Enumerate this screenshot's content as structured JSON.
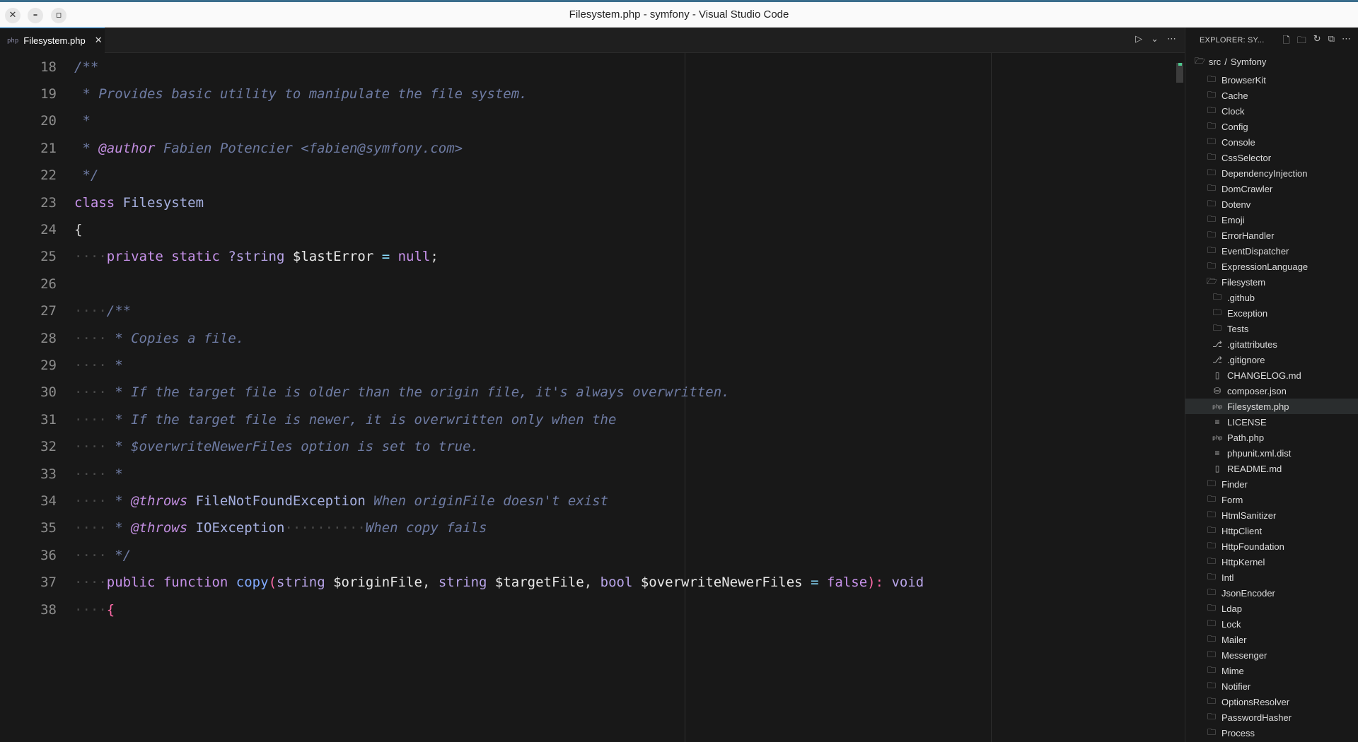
{
  "window": {
    "title": "Filesystem.php - symfony - Visual Studio Code"
  },
  "tab": {
    "label": "Filesystem.php",
    "icon": "php-file-icon"
  },
  "editor": {
    "lines": [
      {
        "num": "18",
        "tokens": [
          [
            "/**",
            "cm"
          ]
        ]
      },
      {
        "num": "19",
        "tokens": [
          [
            " * Provides basic utility to manipulate the file system.",
            "cm"
          ]
        ]
      },
      {
        "num": "20",
        "tokens": [
          [
            " *",
            "cm"
          ]
        ]
      },
      {
        "num": "21",
        "tokens": [
          [
            " * ",
            "cm"
          ],
          [
            "@author",
            "tag"
          ],
          [
            " Fabien Potencier <fabien@symfony.com>",
            "cm"
          ]
        ]
      },
      {
        "num": "22",
        "tokens": [
          [
            " */",
            "cm"
          ]
        ]
      },
      {
        "num": "23",
        "tokens": [
          [
            "class ",
            "kw"
          ],
          [
            "Filesystem",
            "cls"
          ]
        ]
      },
      {
        "num": "24",
        "tokens": [
          [
            "{",
            "plain"
          ]
        ]
      },
      {
        "num": "25",
        "tokens": [
          [
            "····",
            "ws"
          ],
          [
            "private static ",
            "kw"
          ],
          [
            "?string ",
            "type"
          ],
          [
            "$lastError",
            "var"
          ],
          [
            " = ",
            "op"
          ],
          [
            "null",
            "kw"
          ],
          [
            ";",
            "plain"
          ]
        ]
      },
      {
        "num": "26",
        "tokens": []
      },
      {
        "num": "27",
        "tokens": [
          [
            "····",
            "ws"
          ],
          [
            "/**",
            "cm"
          ]
        ]
      },
      {
        "num": "28",
        "tokens": [
          [
            "····",
            "ws"
          ],
          [
            " * Copies a file.",
            "cm"
          ]
        ]
      },
      {
        "num": "29",
        "tokens": [
          [
            "····",
            "ws"
          ],
          [
            " *",
            "cm"
          ]
        ]
      },
      {
        "num": "30",
        "tokens": [
          [
            "····",
            "ws"
          ],
          [
            " * If the target file is older than the origin file, it's always overwritten.",
            "cm"
          ]
        ]
      },
      {
        "num": "31",
        "tokens": [
          [
            "····",
            "ws"
          ],
          [
            " * If the target file is newer, it is overwritten only when the",
            "cm"
          ]
        ]
      },
      {
        "num": "32",
        "tokens": [
          [
            "····",
            "ws"
          ],
          [
            " * $overwriteNewerFiles option is set to true.",
            "cm"
          ]
        ]
      },
      {
        "num": "33",
        "tokens": [
          [
            "····",
            "ws"
          ],
          [
            " *",
            "cm"
          ]
        ]
      },
      {
        "num": "34",
        "tokens": [
          [
            "····",
            "ws"
          ],
          [
            " * ",
            "cm"
          ],
          [
            "@throws",
            "tag"
          ],
          [
            " FileNotFoundException",
            "cls"
          ],
          [
            " When originFile doesn't exist",
            "cm"
          ]
        ]
      },
      {
        "num": "35",
        "tokens": [
          [
            "····",
            "ws"
          ],
          [
            " * ",
            "cm"
          ],
          [
            "@throws",
            "tag"
          ],
          [
            " IOException",
            "cls"
          ],
          [
            "··········",
            "ws"
          ],
          [
            "When copy fails",
            "cm"
          ]
        ]
      },
      {
        "num": "36",
        "tokens": [
          [
            "····",
            "ws"
          ],
          [
            " */",
            "cm"
          ]
        ]
      },
      {
        "num": "37",
        "tokens": [
          [
            "····",
            "ws"
          ],
          [
            "public function ",
            "kw"
          ],
          [
            "copy",
            "fn"
          ],
          [
            "(",
            "brace"
          ],
          [
            "string ",
            "type"
          ],
          [
            "$originFile",
            "var"
          ],
          [
            ", ",
            "plain"
          ],
          [
            "string ",
            "type"
          ],
          [
            "$targetFile",
            "var"
          ],
          [
            ", ",
            "plain"
          ],
          [
            "bool ",
            "type"
          ],
          [
            "$overwriteNewerFiles",
            "var"
          ],
          [
            " = ",
            "op"
          ],
          [
            "false",
            "kw"
          ],
          [
            "): ",
            "brace"
          ],
          [
            "void",
            "type"
          ]
        ]
      },
      {
        "num": "38",
        "tokens": [
          [
            "····",
            "ws"
          ],
          [
            "{",
            "brace"
          ]
        ]
      }
    ]
  },
  "explorer": {
    "header": "EXPLORER: SY...",
    "crumb": {
      "part1": "src",
      "sep": "/",
      "part2": "Symfony"
    },
    "items": [
      {
        "label": "BrowserKit",
        "icon": "folder-icon",
        "depth": 1
      },
      {
        "label": "Cache",
        "icon": "folder-icon",
        "depth": 1
      },
      {
        "label": "Clock",
        "icon": "folder-icon",
        "depth": 1
      },
      {
        "label": "Config",
        "icon": "folder-icon",
        "depth": 1
      },
      {
        "label": "Console",
        "icon": "folder-icon",
        "depth": 1
      },
      {
        "label": "CssSelector",
        "icon": "folder-icon",
        "depth": 1
      },
      {
        "label": "DependencyInjection",
        "icon": "folder-icon",
        "depth": 1
      },
      {
        "label": "DomCrawler",
        "icon": "folder-icon",
        "depth": 1
      },
      {
        "label": "Dotenv",
        "icon": "folder-icon",
        "depth": 1
      },
      {
        "label": "Emoji",
        "icon": "folder-icon",
        "depth": 1
      },
      {
        "label": "ErrorHandler",
        "icon": "folder-icon",
        "depth": 1
      },
      {
        "label": "EventDispatcher",
        "icon": "folder-icon",
        "depth": 1
      },
      {
        "label": "ExpressionLanguage",
        "icon": "folder-icon",
        "depth": 1
      },
      {
        "label": "Filesystem",
        "icon": "folder-open-icon",
        "depth": 1
      },
      {
        "label": ".github",
        "icon": "folder-icon",
        "depth": 2
      },
      {
        "label": "Exception",
        "icon": "folder-icon",
        "depth": 2
      },
      {
        "label": "Tests",
        "icon": "folder-icon",
        "depth": 2
      },
      {
        "label": ".gitattributes",
        "icon": "git-icon",
        "depth": 2
      },
      {
        "label": ".gitignore",
        "icon": "git-icon",
        "depth": 2
      },
      {
        "label": "CHANGELOG.md",
        "icon": "book-icon",
        "depth": 2
      },
      {
        "label": "composer.json",
        "icon": "database-icon",
        "depth": 2
      },
      {
        "label": "Filesystem.php",
        "icon": "php-file-icon",
        "depth": 2,
        "selected": true
      },
      {
        "label": "LICENSE",
        "icon": "lines-icon",
        "depth": 2
      },
      {
        "label": "Path.php",
        "icon": "php-file-icon",
        "depth": 2
      },
      {
        "label": "phpunit.xml.dist",
        "icon": "lines-icon",
        "depth": 2
      },
      {
        "label": "README.md",
        "icon": "book-icon",
        "depth": 2
      },
      {
        "label": "Finder",
        "icon": "folder-icon",
        "depth": 1
      },
      {
        "label": "Form",
        "icon": "folder-icon",
        "depth": 1
      },
      {
        "label": "HtmlSanitizer",
        "icon": "folder-icon",
        "depth": 1
      },
      {
        "label": "HttpClient",
        "icon": "folder-icon",
        "depth": 1
      },
      {
        "label": "HttpFoundation",
        "icon": "folder-icon",
        "depth": 1
      },
      {
        "label": "HttpKernel",
        "icon": "folder-icon",
        "depth": 1
      },
      {
        "label": "Intl",
        "icon": "folder-icon",
        "depth": 1
      },
      {
        "label": "JsonEncoder",
        "icon": "folder-icon",
        "depth": 1
      },
      {
        "label": "Ldap",
        "icon": "folder-icon",
        "depth": 1
      },
      {
        "label": "Lock",
        "icon": "folder-icon",
        "depth": 1
      },
      {
        "label": "Mailer",
        "icon": "folder-icon",
        "depth": 1
      },
      {
        "label": "Messenger",
        "icon": "folder-icon",
        "depth": 1
      },
      {
        "label": "Mime",
        "icon": "folder-icon",
        "depth": 1
      },
      {
        "label": "Notifier",
        "icon": "folder-icon",
        "depth": 1
      },
      {
        "label": "OptionsResolver",
        "icon": "folder-icon",
        "depth": 1
      },
      {
        "label": "PasswordHasher",
        "icon": "folder-icon",
        "depth": 1
      },
      {
        "label": "Process",
        "icon": "folder-icon",
        "depth": 1
      }
    ]
  }
}
